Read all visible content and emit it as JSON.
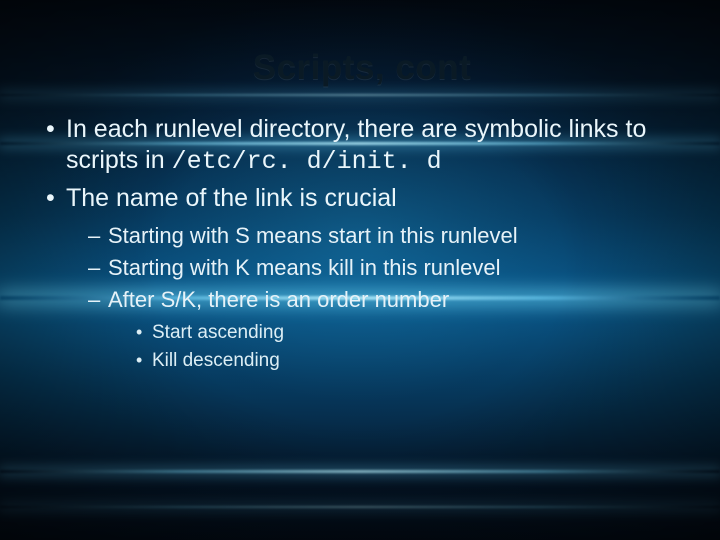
{
  "title": "Scripts, cont",
  "bullets": {
    "b1_pre": "In each runlevel directory, there are symbolic links to scripts in ",
    "b1_code": "/etc/rc. d/init. d",
    "b2": "The name of the link is crucial",
    "sub": {
      "s1": "Starting with S means start in this runlevel",
      "s2": "Starting with K means kill in this runlevel",
      "s3": "After S/K, there is an order number",
      "ssub": {
        "t1": "Start ascending",
        "t2": "Kill descending"
      }
    }
  }
}
